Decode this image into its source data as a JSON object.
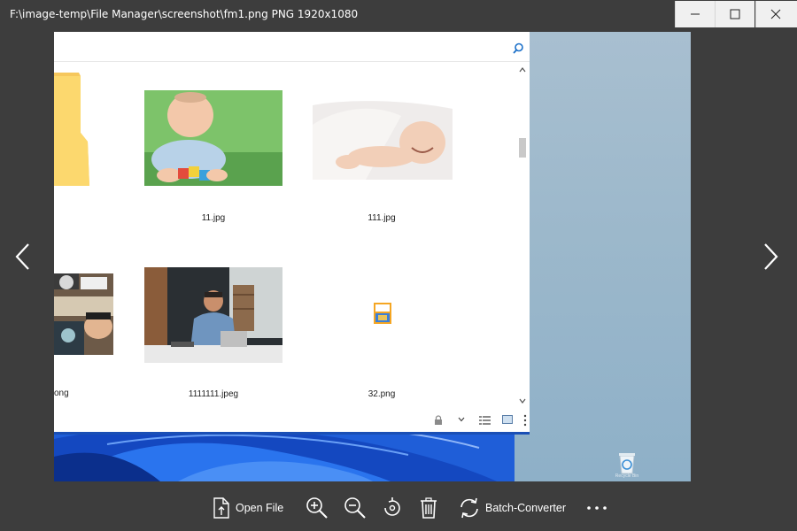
{
  "window": {
    "title": "F:\\image-temp\\File Manager\\screenshot\\fm1.png PNG 1920x1080",
    "minimize_icon": "minimize-icon",
    "maximize_icon": "maximize-icon",
    "close_icon": "close-icon"
  },
  "navigation": {
    "prev_icon": "chevron-left-icon",
    "next_icon": "chevron-right-icon"
  },
  "screenshot": {
    "file_items": [
      {
        "label": "",
        "kind": "folder"
      },
      {
        "label": "11.jpg",
        "kind": "image"
      },
      {
        "label": "111.jpg",
        "kind": "image"
      },
      {
        "label": "ong",
        "kind": "image"
      },
      {
        "label": "1111111.jpeg",
        "kind": "image"
      },
      {
        "label": "32.png",
        "kind": "png-file"
      }
    ],
    "desktop_icon_label": "Recycle Bin"
  },
  "toolbar": {
    "open_file": "Open File",
    "batch_converter": "Batch-Converter",
    "icons": [
      "open-file-icon",
      "zoom-in-icon",
      "zoom-out-icon",
      "rotate-icon",
      "delete-icon",
      "batch-converter-icon",
      "more-icon"
    ]
  }
}
